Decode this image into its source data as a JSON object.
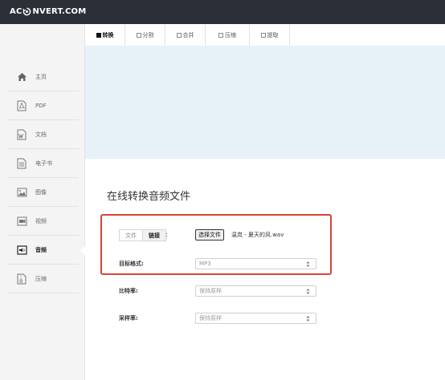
{
  "app": {
    "logo_text_left": "AC",
    "logo_text_right": "NVERT.COM"
  },
  "tabs": [
    {
      "label": "转换",
      "active": true
    },
    {
      "label": "分割",
      "active": false
    },
    {
      "label": "合并",
      "active": false
    },
    {
      "label": "压缩",
      "active": false
    },
    {
      "label": "提取",
      "active": false
    }
  ],
  "sidebar": {
    "items": [
      {
        "label": "主页",
        "icon": "home-icon"
      },
      {
        "label": "PDF",
        "icon": "pdf-icon"
      },
      {
        "label": "文档",
        "icon": "word-document-icon"
      },
      {
        "label": "电子书",
        "icon": "ebook-icon"
      },
      {
        "label": "图像",
        "icon": "image-icon"
      },
      {
        "label": "视频",
        "icon": "video-icon"
      },
      {
        "label": "音频",
        "icon": "audio-icon",
        "active": true
      },
      {
        "label": "压缩",
        "icon": "archive-icon"
      }
    ]
  },
  "main": {
    "title": "在线转换音频文件",
    "source_toggle": {
      "file_label": "文件",
      "link_label": "链接",
      "colon": ":"
    },
    "choose_file_label": "选择文件",
    "selected_file": "温岚 - 夏天的风.wav",
    "target_format": {
      "label": "目标格式:",
      "value": "MP3"
    },
    "bitrate": {
      "label": "比特率:",
      "value": "保持原样"
    },
    "sample_rate": {
      "label": "采样率:",
      "value": "保持原样"
    }
  },
  "colors": {
    "topbar": "#2b3038",
    "banner": "#e7f1f8",
    "highlight_border": "#d64533",
    "sidebar_bg": "#f4f4f4"
  }
}
